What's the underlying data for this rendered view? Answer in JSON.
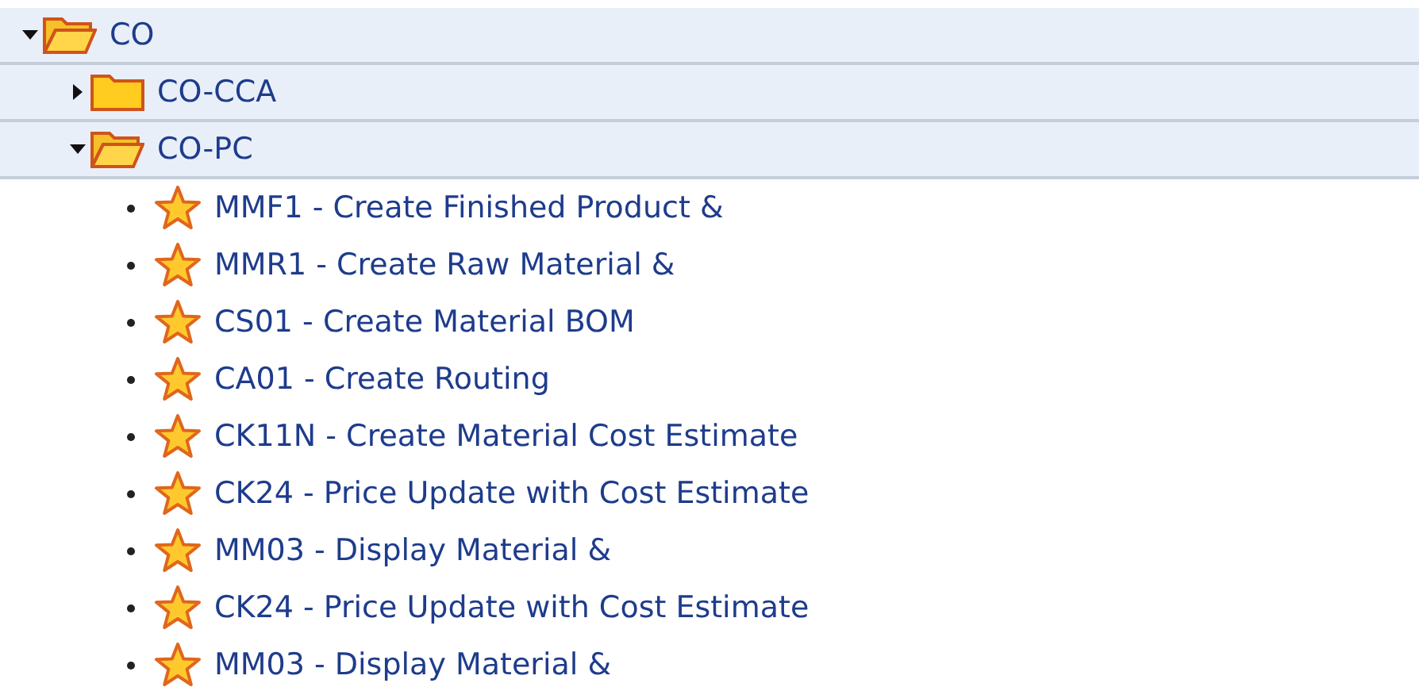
{
  "tree": [
    {
      "kind": "folder",
      "label": "CO",
      "expanded": true,
      "children": [
        {
          "kind": "folder",
          "label": "CO-CCA",
          "expanded": false
        },
        {
          "kind": "folder",
          "label": "CO-PC",
          "expanded": true,
          "children": [
            {
              "kind": "transaction",
              "label": "MMF1 - Create Finished Product &"
            },
            {
              "kind": "transaction",
              "label": "MMR1 - Create Raw Material &"
            },
            {
              "kind": "transaction",
              "label": "CS01 - Create Material BOM"
            },
            {
              "kind": "transaction",
              "label": "CA01 - Create Routing"
            },
            {
              "kind": "transaction",
              "label": "CK11N - Create Material Cost Estimate"
            },
            {
              "kind": "transaction",
              "label": "CK24 - Price Update with Cost Estimate"
            },
            {
              "kind": "transaction",
              "label": "MM03 - Display Material &"
            },
            {
              "kind": "transaction",
              "label": "CK24 - Price Update with Cost Estimate"
            },
            {
              "kind": "transaction",
              "label": "MM03 - Display Material &"
            }
          ]
        }
      ]
    }
  ]
}
